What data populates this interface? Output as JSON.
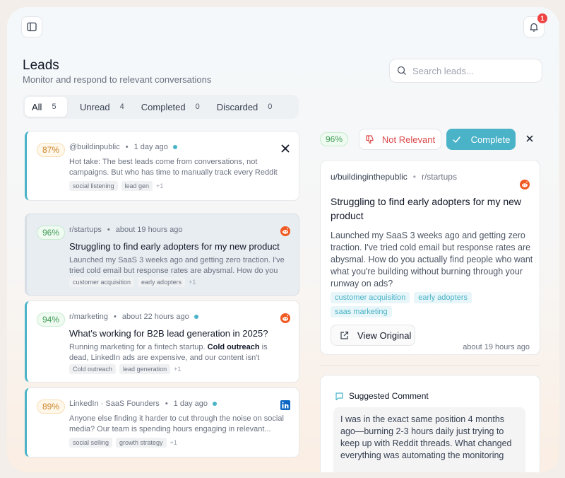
{
  "header": {
    "title": "Leads",
    "subtitle": "Monitor and respond to relevant conversations",
    "notification_count": "1"
  },
  "search": {
    "placeholder": "Search leads..."
  },
  "tabs": [
    {
      "label": "All",
      "count": "5"
    },
    {
      "label": "Unread",
      "count": "4"
    },
    {
      "label": "Completed",
      "count": "0"
    },
    {
      "label": "Discarded",
      "count": "0"
    }
  ],
  "leads": [
    {
      "score": "87%",
      "source": "@buildinpublic",
      "time": "1 day ago",
      "platform": "x-icon",
      "title": "",
      "body": "Hot take: The best leads come from conversations, not campaigns. But who has time to manually track every Reddit thread?",
      "tags": [
        "social listening",
        "lead gen"
      ],
      "more": "+1"
    },
    {
      "score": "96%",
      "source": "r/startups",
      "time": "about 19 hours ago",
      "platform": "reddit-icon",
      "title": "Struggling to find early adopters for my new product",
      "body": "Launched my SaaS 3 weeks ago and getting zero traction. I've tried cold email but response rates are abysmal. How do you actually find people?",
      "tags": [
        "customer acquisition",
        "early adopters"
      ],
      "more": "+1"
    },
    {
      "score": "94%",
      "source": "r/marketing",
      "time": "about 22 hours ago",
      "platform": "reddit-icon",
      "title": "What's working for B2B lead generation in 2025?",
      "body_pre": "Running marketing for a fintech startup. ",
      "body_bold": "Cold outreach",
      "body_post": " is dead, LinkedIn ads are expensive, and our content isn't converting....",
      "tags": [
        "Cold outreach",
        "lead generation"
      ],
      "more": "+1"
    },
    {
      "score": "89%",
      "source": "LinkedIn · SaaS Founders",
      "time": "1 day ago",
      "platform": "linkedin-icon",
      "title": "",
      "body": "Anyone else finding it harder to cut through the noise on social media? Our team is spending hours engaging in relevant...",
      "tags": [
        "social selling",
        "growth strategy"
      ],
      "more": "+1"
    }
  ],
  "detail": {
    "score": "96%",
    "not_relevant_label": "Not Relevant",
    "complete_label": "Complete",
    "author": "u/buildinginthepublic",
    "subreddit": "r/startups",
    "title": "Struggling to find early adopters for my new product",
    "body": "Launched my SaaS 3 weeks ago and getting zero traction. I've tried cold email but response rates are abysmal. How do you actually find people who want what you're building without burning through your runway on ads?",
    "tags": [
      "customer acquisition",
      "early adopters",
      "saas marketing"
    ],
    "view_original_label": "View Original",
    "time": "about 19 hours ago"
  },
  "suggested": {
    "heading": "Suggested Comment",
    "text": "I was in the exact same position 4 months ago—burning 2-3 hours daily just trying to keep up with Reddit threads. What changed everything was automating the monitoring"
  },
  "colors": {
    "accent": "#4ab3c8",
    "danger": "#dc4a4a",
    "badge": "#ef4444"
  }
}
